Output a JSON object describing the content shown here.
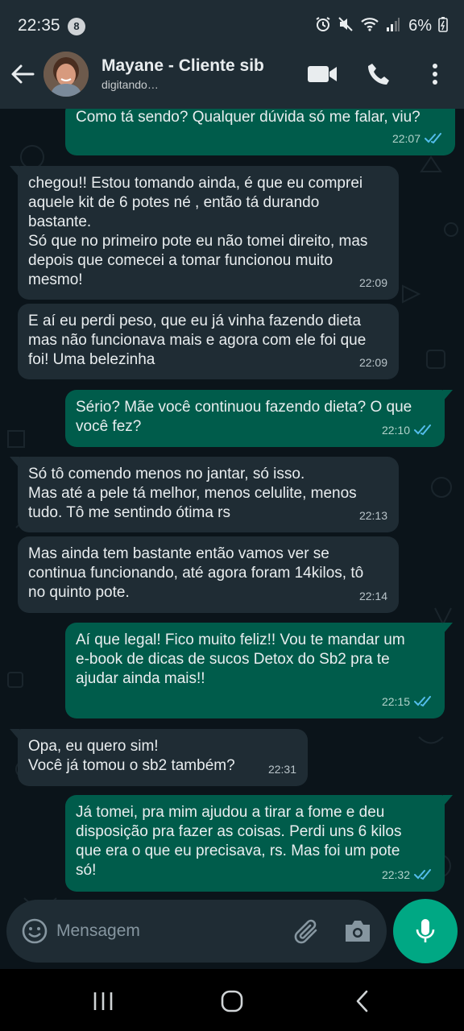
{
  "status_bar": {
    "time": "22:35",
    "notification_count": "8",
    "battery": "6%",
    "icons": [
      "alarm-icon",
      "mute-icon",
      "wifi-icon",
      "signal-icon",
      "battery-icon"
    ]
  },
  "header": {
    "contact_name": "Mayane - Cliente sib",
    "contact_status": "digitando…",
    "icons": [
      "back-arrow-icon",
      "video-call-icon",
      "phone-icon",
      "more-options-icon"
    ]
  },
  "messages": [
    {
      "direction": "out",
      "text": "Como tá sendo? Qualquer dúvida só me falar, viu?",
      "time": "22:07",
      "read": true
    },
    {
      "direction": "in",
      "text": "chegou!! Estou tomando ainda, é que eu comprei\naquele kit de 6 potes né , então tá durando\nbastante.\nSó que no primeiro pote eu não tomei direito, mas\ndepois que comecei a tomar funcionou muito\nmesmo!",
      "time": "22:09"
    },
    {
      "direction": "in",
      "text": "E aí eu perdi peso, que eu já vinha fazendo dieta\nmas não funcionava mais e agora com ele foi que\nfoi! Uma belezinha",
      "time": "22:09"
    },
    {
      "direction": "out",
      "text": "Sério? Mãe você continuou fazendo dieta? O que\nvocê fez?",
      "time": "22:10",
      "read": true
    },
    {
      "direction": "in",
      "text": "Só tô comendo menos no jantar, só isso.\nMas até a pele tá melhor, menos celulite, menos\ntudo. Tô me sentindo ótima rs",
      "time": "22:13"
    },
    {
      "direction": "in",
      "text": "Mas ainda tem bastante então vamos ver se\ncontinua funcionando, até agora foram 14kilos, tô\nno quinto pote.",
      "time": "22:14"
    },
    {
      "direction": "out",
      "text": "Aí que legal! Fico muito feliz!! Vou te mandar um\ne-book de dicas de sucos Detox do Sb2 pra  te\najudar ainda mais!!",
      "time": "22:15",
      "read": true
    },
    {
      "direction": "in",
      "text": "Opa, eu quero sim!\nVocê já tomou o sb2 também?",
      "time": "22:31"
    },
    {
      "direction": "out",
      "text": "Já tomei, pra mim ajudou a tirar a fome e deu\ndisposição pra fazer as coisas. Perdi uns 6 kilos\nque era o que eu precisava, rs. Mas foi um pote\nsó!",
      "time": "22:32",
      "read": true
    }
  ],
  "composer": {
    "placeholder": "Mensagem",
    "icons": [
      "emoji-icon",
      "attach-icon",
      "camera-icon",
      "mic-icon"
    ]
  },
  "colors": {
    "bar_bg": "#1f2c34",
    "chat_bg": "#0b141a",
    "outgoing_bubble": "#005c4b",
    "incoming_bubble": "#1f2c34",
    "accent": "#00a884",
    "read_check": "#53bdeb"
  },
  "nav_bar": {
    "icons": [
      "recent-apps-icon",
      "home-icon",
      "back-icon"
    ]
  }
}
